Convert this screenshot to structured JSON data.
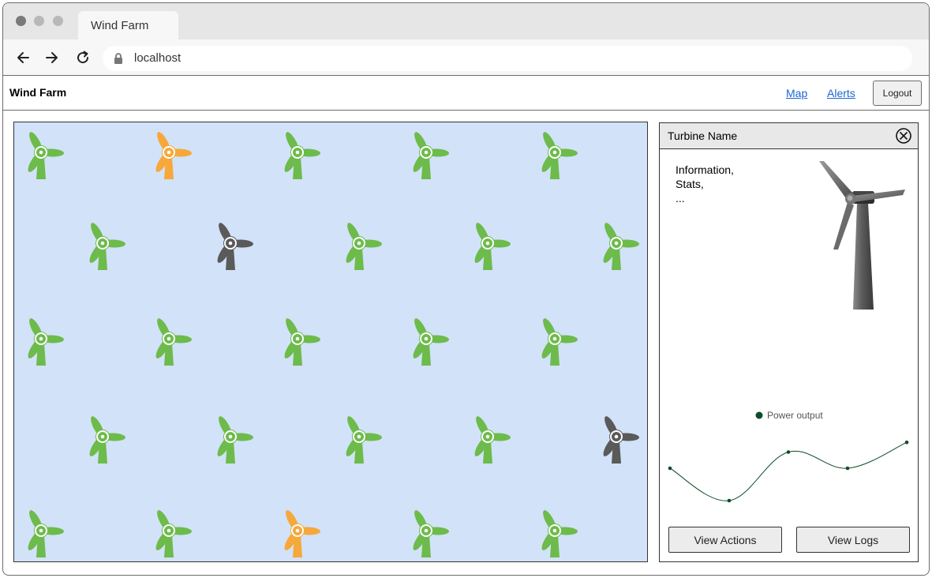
{
  "browser": {
    "tab_title": "Wind Farm",
    "url": "localhost"
  },
  "app": {
    "brand": "Wind Farm",
    "nav": {
      "map": "Map",
      "alerts": "Alerts",
      "logout": "Logout"
    }
  },
  "map": {
    "status_colors": {
      "ok": "#6dbb4b",
      "warning": "#f6a83a",
      "offline": "#5a5a5a"
    },
    "background": "#d2e2f8",
    "turbine_rows": [
      [
        "ok",
        "warning",
        "ok",
        "ok",
        "ok"
      ],
      [
        "ok",
        "offline",
        "ok",
        "ok",
        "ok"
      ],
      [
        "ok",
        "ok",
        "ok",
        "ok",
        "ok"
      ],
      [
        "ok",
        "ok",
        "ok",
        "ok",
        "offline"
      ],
      [
        "ok",
        "ok",
        "warning",
        "ok",
        "ok"
      ]
    ],
    "turbine_icon": "wind-turbine-icon"
  },
  "panel": {
    "title": "Turbine Name",
    "info_lines": [
      "Information,",
      "Stats,",
      "..."
    ],
    "chart_data": {
      "type": "line",
      "series": [
        {
          "name": "Power output",
          "values": [
            0.5,
            0.0,
            0.75,
            0.5,
            0.9
          ]
        }
      ],
      "color": "#0d4d2a",
      "grid": false,
      "legend": "top"
    },
    "buttons": {
      "view_actions": "View Actions",
      "view_logs": "View Logs"
    }
  }
}
